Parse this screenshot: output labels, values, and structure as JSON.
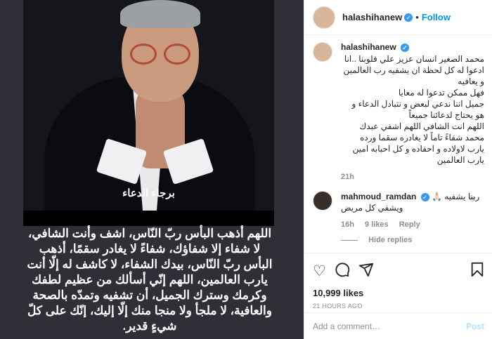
{
  "post": {
    "author": "halashihanew",
    "follow_label": "Follow",
    "image_title": "برجاء الدعاء",
    "image_prayer": "اللهم أذهب البأس ربّ النّاس، اشف وأنت الشافي، لا شفاء إلا شفاؤك، شفاءً لا يغادر سقمًا، أذهب البأس ربّ النّاس، بيدك الشفاء، لا كاشف له إلّا أنت يارب العالمين، اللهم إنّي أسألك من عظيم لطفك وكرمك وسترك الجميل، أن تشفيه وتمدّه بالصحة والعافية، لا ملجأ ولا منجا منك إلّا إليك، إنّك على كلّ شيءٍ قدير."
  },
  "caption": {
    "username": "halashihanew",
    "text": "محمد الصغير انسان عزيز علي قلوبنا ..انا ادعوا له كل لحظة ان يشفيه رب العالمين و يعافيه\nفهل ممكن تدعوا له معايا\nجميل اننا ندعي لبعض و نتبادل الدعاء و هو يحتاج لدعائنا جميعاً\nاللهم انت الشافي اللهم اشفي عبدك محمد شفاءً تاماً لا يغادره سقما ورده يارب لاولاده و احفاده و كل احبابه امين يارب العالمين",
    "time": "21h"
  },
  "comment": {
    "username": "mahmoud_ramdan",
    "text": "ربنا يشفيه 🙏🏻ويشفي كل مريض",
    "time": "16h",
    "likes": "9 likes",
    "reply_label": "Reply",
    "hide_replies": "Hide replies"
  },
  "stats": {
    "likes": "10,999 likes",
    "time": "21 HOURS AGO"
  },
  "compose": {
    "placeholder": "Add a comment…",
    "post_label": "Post"
  },
  "icons": {
    "heart": "heart-icon",
    "comment": "comment-icon",
    "share": "share-icon",
    "bookmark": "bookmark-icon",
    "verified": "verified-badge-icon"
  },
  "colors": {
    "accent": "#0095f6",
    "verified": "#3897f0",
    "muted": "#8e8e8e"
  }
}
